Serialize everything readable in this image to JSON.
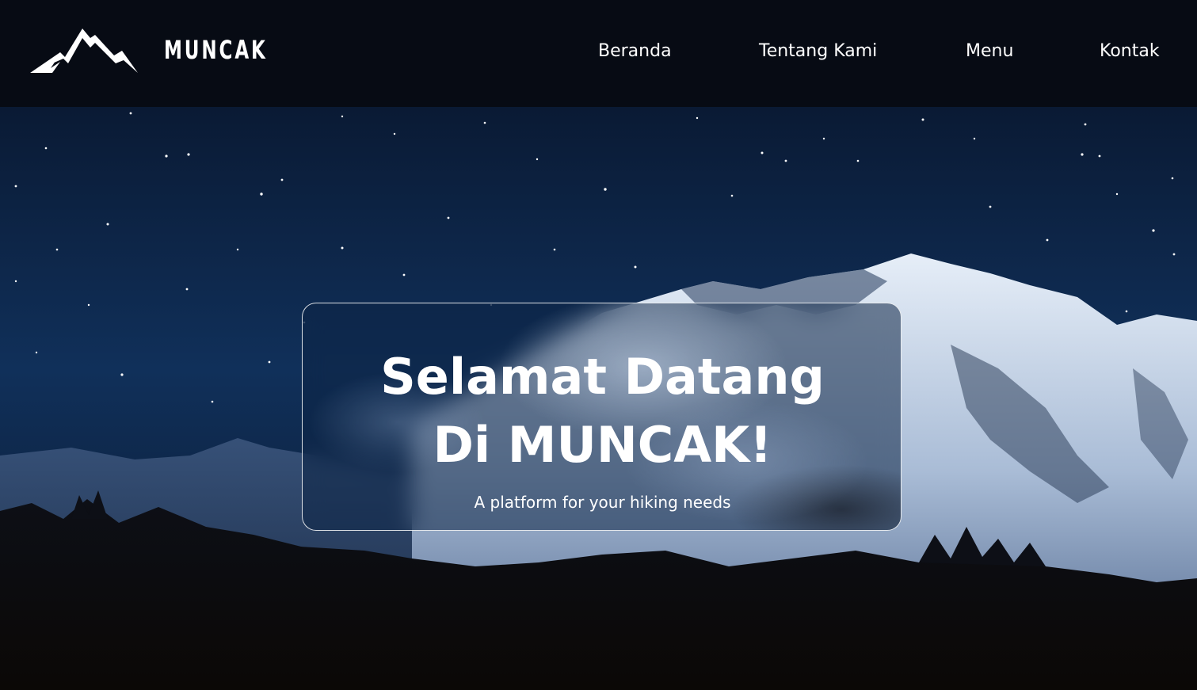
{
  "header": {
    "brand_name": "MUNCAK",
    "logo_icon": "mountain-logo-icon",
    "nav": [
      {
        "label": "Beranda"
      },
      {
        "label": "Tentang Kami"
      },
      {
        "label": "Menu"
      },
      {
        "label": "Kontak"
      }
    ]
  },
  "hero": {
    "title_line1": "Selamat Datang",
    "title_line2": "Di MUNCAK!",
    "subtitle": "A platform for your hiking needs",
    "background": "night-sky-snowy-mountain-image"
  },
  "colors": {
    "header_bg": "#070b14",
    "sky_top": "#0a1a33",
    "text": "#ffffff"
  }
}
